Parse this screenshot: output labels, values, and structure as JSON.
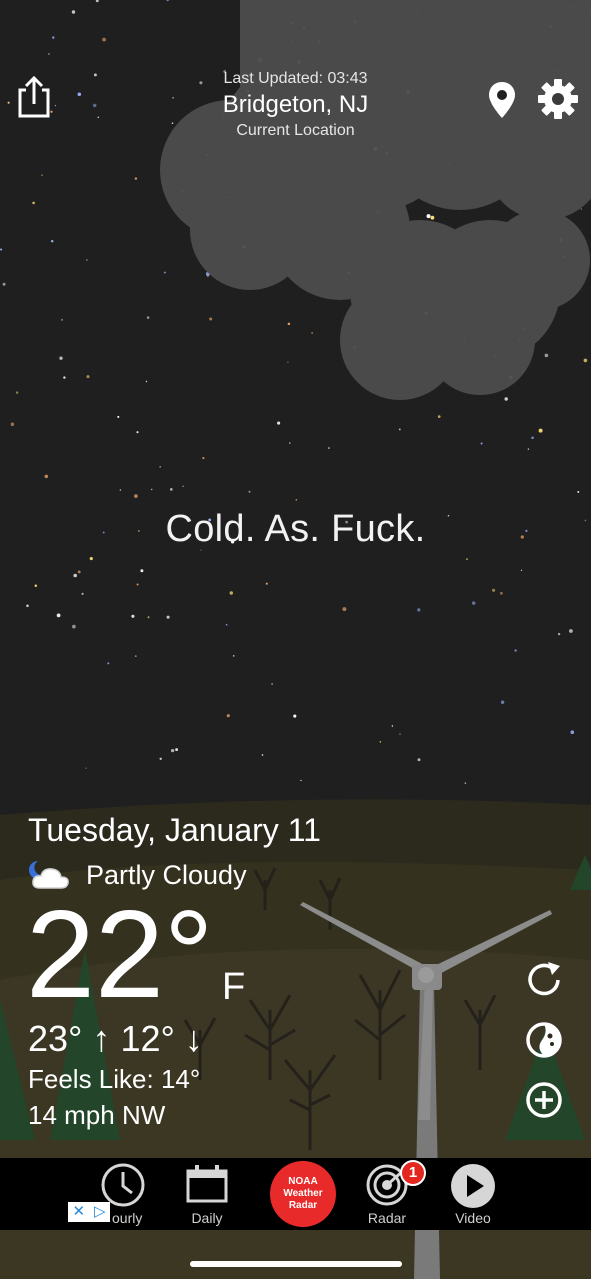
{
  "header": {
    "last_updated": "Last Updated: 03:43",
    "city": "Bridgeton, NJ",
    "location_label": "Current Location"
  },
  "icons": {
    "share": "share-icon",
    "location": "location-pin-icon",
    "settings": "gear-icon",
    "condition": "partly-cloudy-night-icon",
    "refresh": "refresh-icon",
    "theme": "theme-icon",
    "add": "add-location-icon"
  },
  "phrase": "Cold. As. Fuck.",
  "weather": {
    "date": "Tuesday, January 11",
    "condition": "Partly Cloudy",
    "temperature": "22°",
    "unit": "F",
    "high": "23°",
    "low": "12°",
    "feels_like": "Feels Like: 14°",
    "wind": "14 mph NW"
  },
  "tabs": [
    {
      "label": "ourly",
      "icon": "clock-icon"
    },
    {
      "label": "Daily",
      "icon": "calendar-icon"
    },
    {
      "label": "Radar",
      "icon": "radar-icon",
      "badge": "1"
    },
    {
      "label": "Video",
      "icon": "play-icon"
    }
  ],
  "ad": {
    "lines": [
      "NOAA",
      "Weather",
      "Radar"
    ],
    "color": "#e82a2a"
  },
  "colors": {
    "sky": "#1f1f1f",
    "ground": "#2f2a1d",
    "cloud": "#4a4a4a",
    "tabbar": "#000000",
    "badge": "#e3261f"
  }
}
